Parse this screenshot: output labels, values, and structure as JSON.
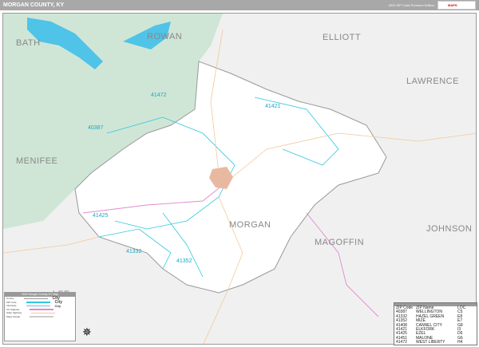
{
  "header": {
    "title": "MORGAN COUNTY, KY",
    "edition": "2020 ZIP Code Premium Edition",
    "logo": "MAPS"
  },
  "map": {
    "counties": [
      "BATH",
      "ROWAN",
      "ELLIOTT",
      "LAWRENCE",
      "MENIFEE",
      "JOHNSON",
      "MAGOFFIN",
      "MORGAN",
      "LFE"
    ],
    "zips": [
      "41472",
      "41421",
      "40387",
      "41425",
      "41332",
      "41352"
    ]
  },
  "legend": {
    "title": "2020 Morgan County KY Map",
    "items": [
      "County",
      "ZIP Code",
      "Interstate",
      "US Highway",
      "State Highway",
      "Major Roads"
    ],
    "city_labels": [
      "City",
      "City",
      "City"
    ]
  },
  "zip_table": {
    "headers": [
      "ZIP Code",
      "ZIP Name",
      "LOC"
    ],
    "rows": [
      [
        "40387",
        "WELLINGTON",
        "C5"
      ],
      [
        "41332",
        "HAZEL GREEN",
        "E8"
      ],
      [
        "41352",
        "MIZE",
        "E7"
      ],
      [
        "41408",
        "CANNEL CITY",
        "G8"
      ],
      [
        "41421",
        "ELKFORK",
        "I3"
      ],
      [
        "41425",
        "EZEL",
        "D6"
      ],
      [
        "41451",
        "MALONE",
        "G6"
      ],
      [
        "41472",
        "WEST LIBERTY",
        "H4"
      ]
    ]
  },
  "colors": {
    "header": "#a8a8a8",
    "forest": "#cfe6d6",
    "water": "#4fc3e8",
    "zip_line": "#2ec7e0",
    "county_fill": "#ffffff",
    "outside": "#f0f0f0"
  }
}
